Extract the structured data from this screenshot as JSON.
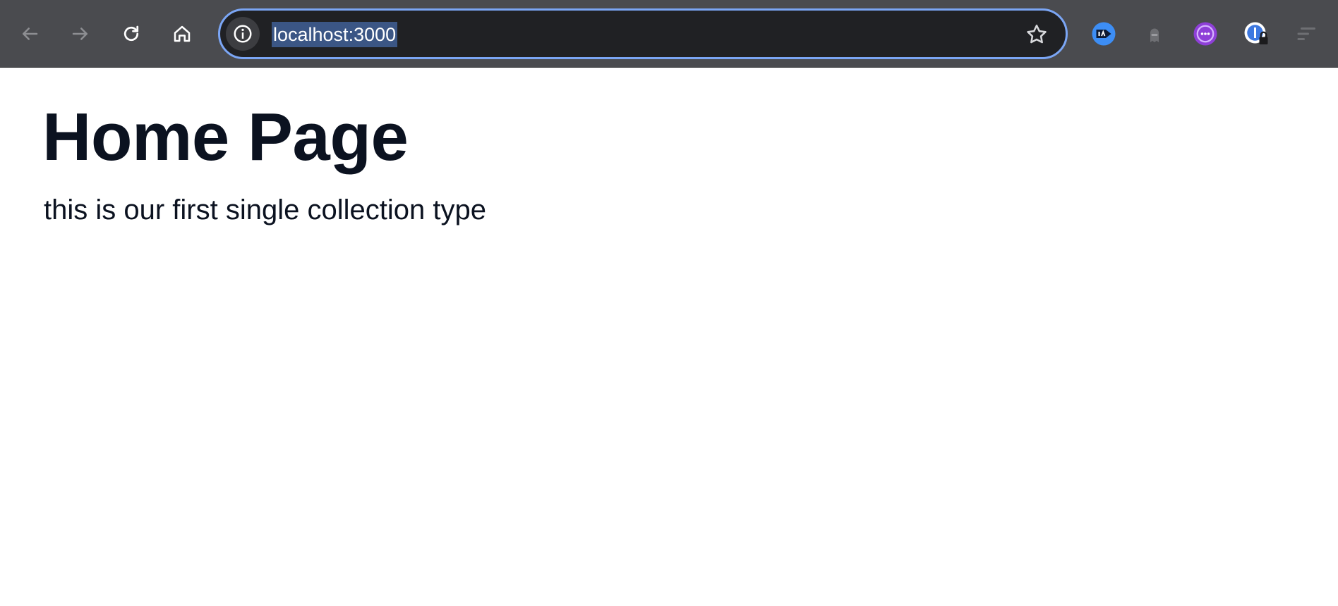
{
  "browser": {
    "url": "localhost:3000",
    "colors": {
      "toolbar": "#4a4b4f",
      "omnibox_bg": "#202124",
      "omnibox_focus_ring": "#7ba6f5",
      "selection": "#3b5685"
    },
    "nav_icons": [
      "back-arrow-icon",
      "forward-arrow-icon",
      "reload-icon",
      "home-icon"
    ],
    "extension_icons": [
      "ia-extension-icon",
      "ghost-extension-icon",
      "purple-extension-icon",
      "password-manager-icon",
      "reading-list-icon"
    ]
  },
  "page": {
    "title": "Home Page",
    "description": "this is our first single collection type",
    "text_color": "#0b1220"
  }
}
